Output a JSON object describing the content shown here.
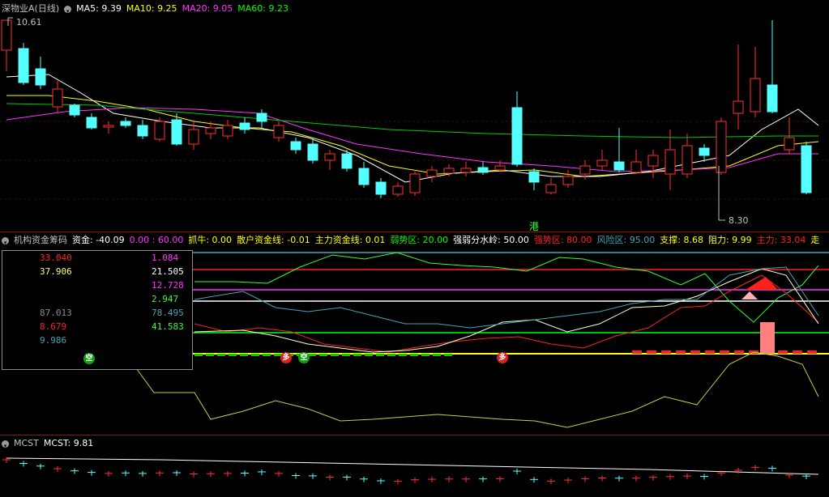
{
  "main_header": {
    "title": "深物业A(日线)",
    "ma5_label": "MA5:",
    "ma5_value": "9.39",
    "ma10_label": "MA10:",
    "ma10_value": "9.25",
    "ma20_label": "MA20:",
    "ma20_value": "9.05",
    "ma60_label": "MA60:",
    "ma60_value": "9.23",
    "high_label": "10.61",
    "low_label": "8.30",
    "gang_label": "港"
  },
  "indicator_header": {
    "title": "机构资金筹码",
    "items": [
      {
        "text": "资金: -40.09",
        "color": "#ffffff"
      },
      {
        "text": "0.00 : 60.00",
        "color": "#ff33ff"
      },
      {
        "text": "抓牛: 0.00",
        "color": "#ffff00"
      },
      {
        "text": "散户资金线: -0.01",
        "color": "#ffff00"
      },
      {
        "text": "主力资金线: 0.01",
        "color": "#ffff00"
      },
      {
        "text": "弱势区: 20.00",
        "color": "#00ff00"
      },
      {
        "text": "强弱分水岭: 50.00",
        "color": "#ffffff"
      },
      {
        "text": "强势区: 80.00",
        "color": "#ff2020"
      },
      {
        "text": "风险区: 95.00",
        "color": "#3fa7b5"
      },
      {
        "text": "支撑: 8.68",
        "color": "#ffff00"
      },
      {
        "text": "阻力: 9.99",
        "color": "#ffff00"
      },
      {
        "text": "主力: 33.04",
        "color": "#ff2020"
      },
      {
        "text": "走",
        "color": "#ffff00"
      }
    ]
  },
  "popup": {
    "left": [
      {
        "text": "33.040",
        "color": "#ff2020"
      },
      {
        "text": "37.906",
        "color": "#ffff66"
      },
      {
        "text": "",
        "color": "#000000"
      },
      {
        "text": "",
        "color": "#000000"
      },
      {
        "text": "87.013",
        "color": "#8c8c8c"
      },
      {
        "text": "8.679",
        "color": "#ff2020"
      },
      {
        "text": "9.986",
        "color": "#3fa7b5"
      }
    ],
    "right": [
      {
        "text": "1.084",
        "color": "#ff33ff"
      },
      {
        "text": "21.505",
        "color": "#ffffff"
      },
      {
        "text": "12.728",
        "color": "#ff33ff"
      },
      {
        "text": "2.947",
        "color": "#33ff33"
      },
      {
        "text": "78.495",
        "color": "#3fa7b5"
      },
      {
        "text": "41.583",
        "color": "#33ff33"
      }
    ],
    "kong_label": "空"
  },
  "badges": [
    {
      "text": "多",
      "color": "#e02020"
    },
    {
      "text": "空",
      "color": "#10a010"
    },
    {
      "text": "多",
      "color": "#e02020"
    }
  ],
  "mcst_header": {
    "title": "MCST",
    "value_label": "MCST: 9.81"
  },
  "colors": {
    "up": "#ff3030",
    "down": "#54ffff",
    "ma5": "#ffffff",
    "ma10": "#ffff00",
    "ma20": "#ff33ff",
    "ma60": "#00cc00",
    "grid": "#8a1010"
  }
}
